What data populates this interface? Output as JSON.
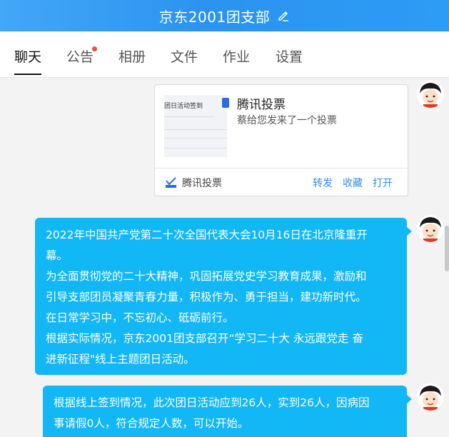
{
  "header": {
    "title": "京东2001团支部",
    "edit_icon": "edit-pencil-icon"
  },
  "tabs": [
    {
      "label": "聊天",
      "active": true
    },
    {
      "label": "公告",
      "has_dot": true
    },
    {
      "label": "相册"
    },
    {
      "label": "文件"
    },
    {
      "label": "作业"
    },
    {
      "label": "设置",
      "has_dropdown": true
    }
  ],
  "vote_card": {
    "thumb_text": "团日活动签到",
    "title": "腾讯投票",
    "subtitle": "蔡给您发来了一个投票",
    "app_name": "腾讯投票",
    "actions": {
      "forward": "转发",
      "favorite": "收藏",
      "open": "打开"
    }
  },
  "messages": [
    {
      "lines": [
        "2022年中国共产党第二十次全国代表大会10月16日在北京隆重开",
        "幕。",
        "为全面贯彻党的二十大精神，巩固拓展党史学习教育成果，激励和",
        "引导支部团员凝聚青春力量，积极作为、勇于担当，建功新时代。",
        "在日常学习中，不忘初心、砥砺前行。",
        "根据实际情况，京东2001团支部召开“学习二十大 永远跟党走 奋",
        "进新征程\"线上主题团日活动。"
      ]
    },
    {
      "lines": [
        "根据线上签到情况，此次团日活动应到26人，实到26人，因病因",
        "事请假0人，符合规定人数，可以开始。"
      ]
    }
  ],
  "colors": {
    "header": "#2d9cf5",
    "bubble": "#12b7f5",
    "link": "#2a8fe8"
  }
}
